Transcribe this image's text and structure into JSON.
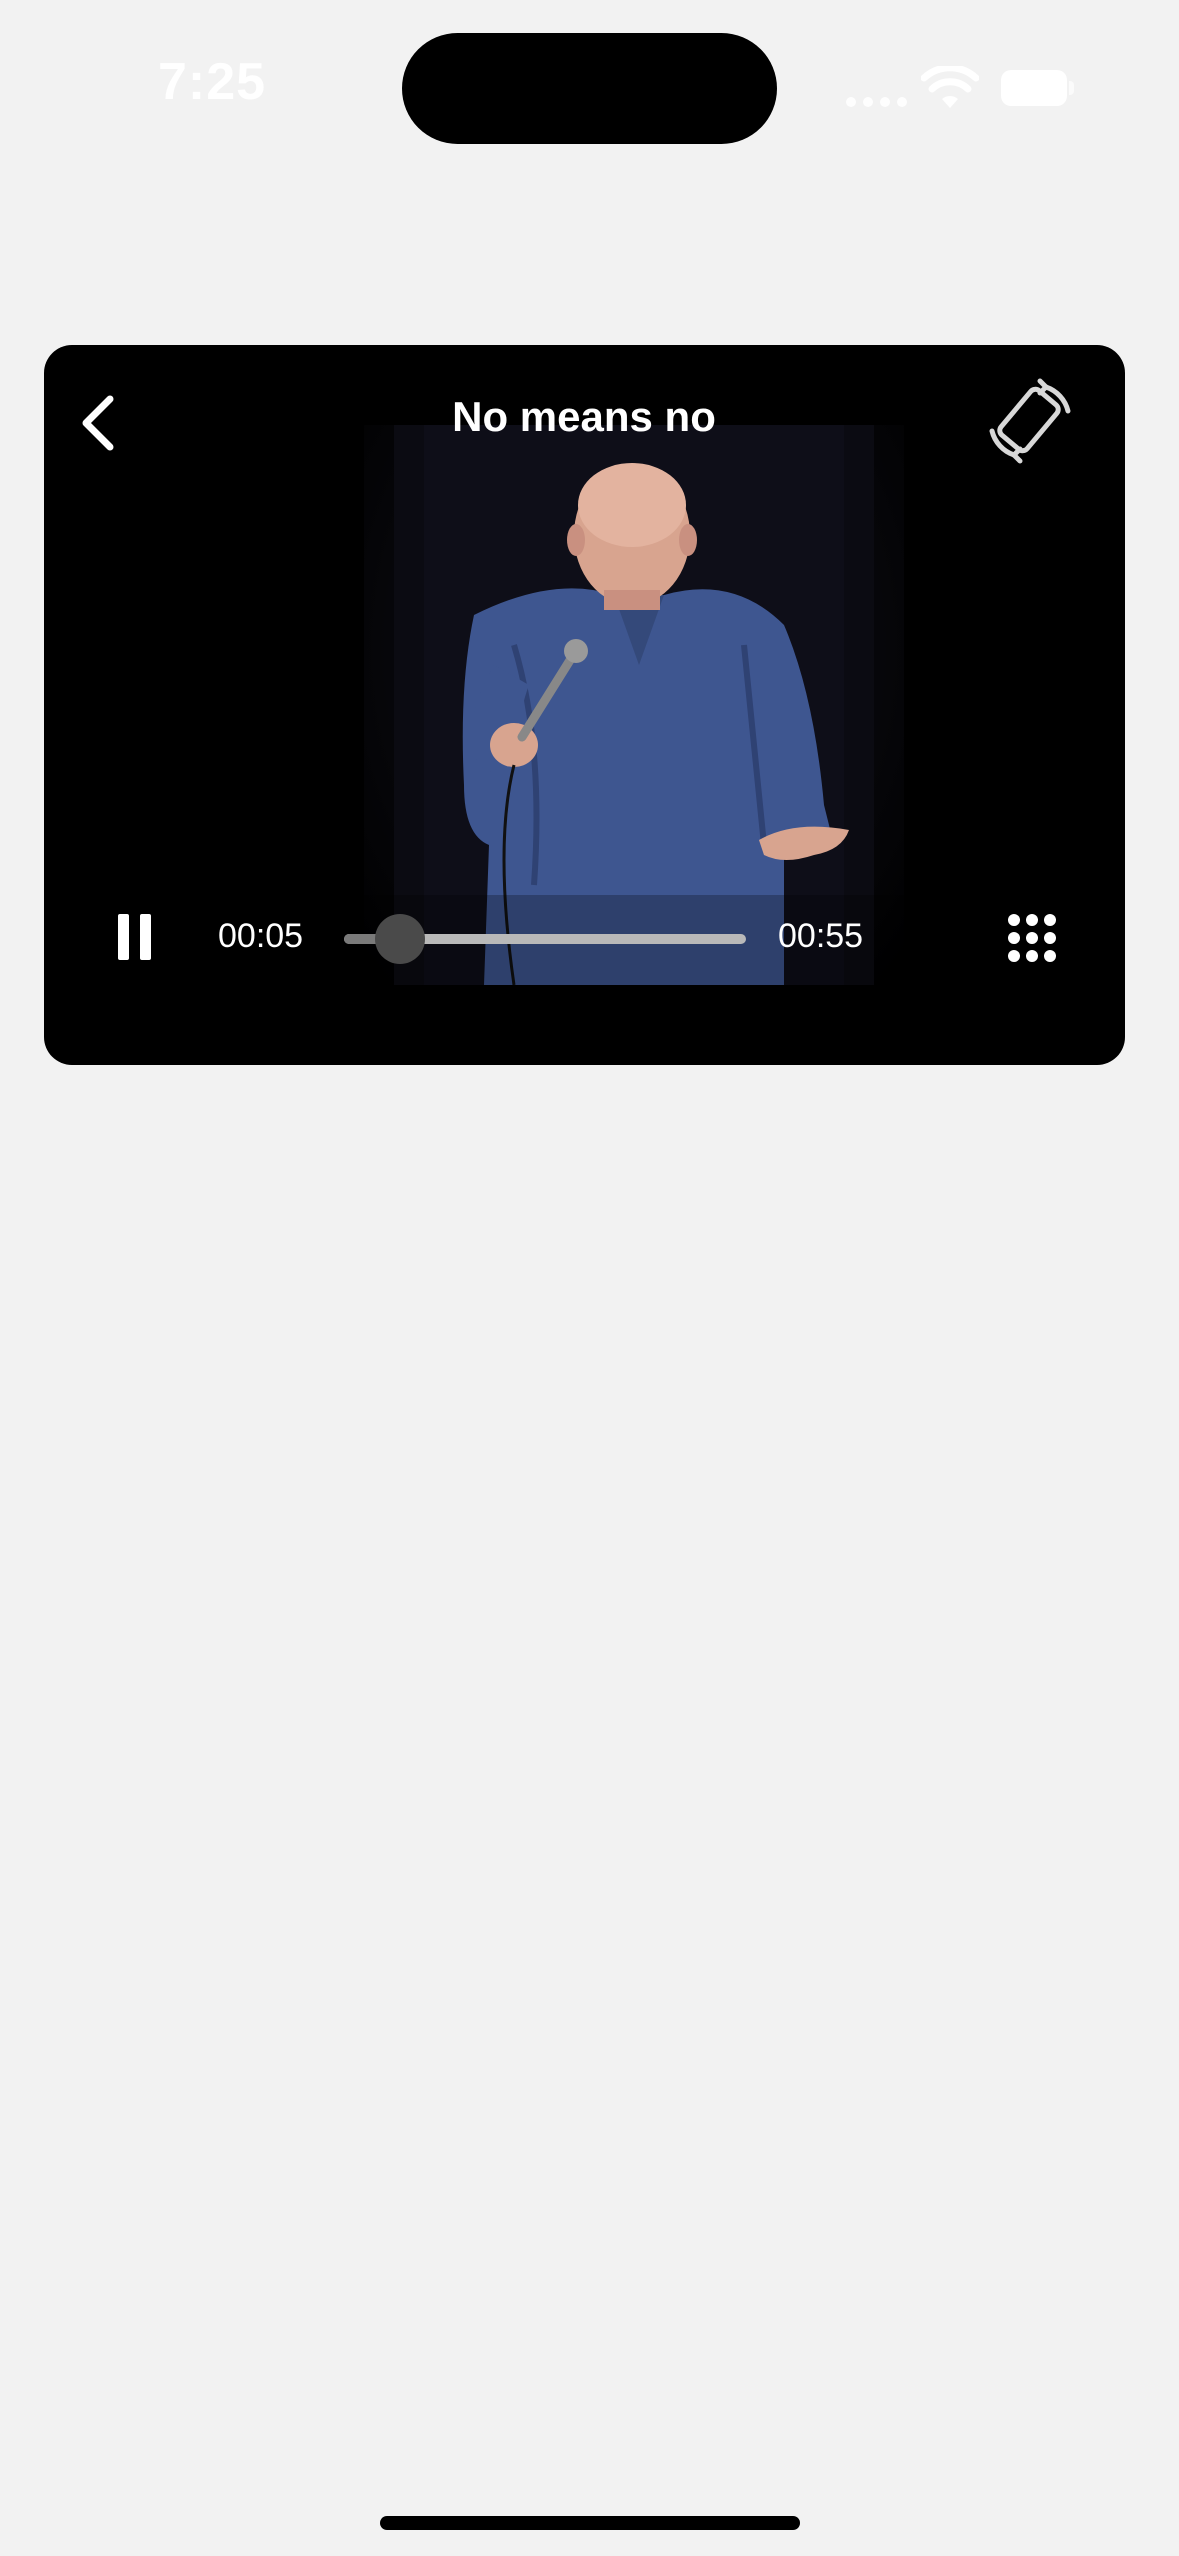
{
  "status_bar": {
    "time": "7:25"
  },
  "player": {
    "title": "No means no",
    "current_time": "00:05",
    "total_time": "00:55",
    "progress_fraction": 0.14,
    "back_icon": "chevron-left-icon",
    "rotate_icon": "rotate-device-icon",
    "pause_icon": "pause-icon",
    "grid_icon": "grid-dots-icon"
  },
  "colors": {
    "page_background": "#f2f2f2",
    "player_background": "#000000",
    "shirt_blue": "#3e5690",
    "seek_track": "#b9b9b9",
    "seek_thumb": "#4a4a4a"
  }
}
